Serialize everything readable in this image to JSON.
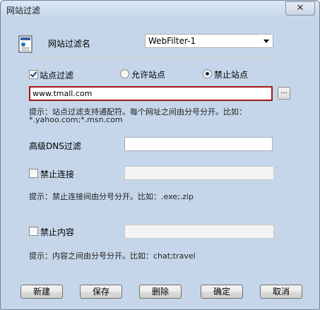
{
  "window": {
    "title": "网站过滤",
    "close_glyph": "✕"
  },
  "filter": {
    "name_label": "网站过滤名",
    "name_value": "WebFilter-1"
  },
  "site_filter": {
    "checkbox_label": "站点过滤",
    "allow_label": "允许站点",
    "block_label": "禁止站点",
    "url_value": "www.tmall.com",
    "browse_label": "...",
    "hint_line1": "提示：站点过滤支持通配符。每个网址之间由分号分开。比如：",
    "hint_line2": "*.yahoo.com;*.msn.com"
  },
  "dns": {
    "label": "高级DNS过滤",
    "value": ""
  },
  "block_connect": {
    "label": "禁止连接",
    "value": "",
    "hint": "提示：禁止连接间由分号分开。比如：.exe;.zip"
  },
  "block_content": {
    "label": "禁止内容",
    "value": "",
    "hint": "提示：内容之间由分号分开。比如：chat;travel"
  },
  "buttons": {
    "new": "新建",
    "save": "保存",
    "delete": "删除",
    "ok": "确定",
    "cancel": "取消"
  }
}
